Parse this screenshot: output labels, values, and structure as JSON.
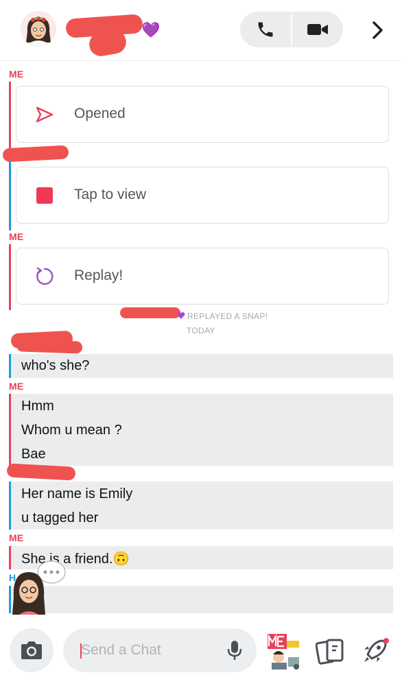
{
  "header": {
    "contact_heart": "💜",
    "call_icon": "phone-icon",
    "video_icon": "video-camera-icon",
    "forward_icon": "chevron-right-icon"
  },
  "labels": {
    "me": "ME",
    "them_partial": "H"
  },
  "snaps": [
    {
      "text": "Opened",
      "icon": "sent-arrow-icon"
    },
    {
      "text": "Tap to view",
      "icon": "red-square-snap-icon"
    },
    {
      "text": "Replay!",
      "icon": "replay-icon"
    }
  ],
  "system": {
    "replayed": "REPLAYED A SNAP!",
    "date": "TODAY"
  },
  "messages": {
    "m1": [
      "who's she?"
    ],
    "m2": [
      "Hmm",
      "Whom u mean ?",
      "Bae"
    ],
    "m3": [
      "Her name is Emily",
      "u tagged her"
    ],
    "m4": [
      "She is a friend.🙃"
    ]
  },
  "composer": {
    "placeholder": "Send a Chat"
  },
  "colors": {
    "me": "#e8415a",
    "them": "#1e9bd7",
    "redaction": "#ef5350",
    "replay": "#9b59c9"
  }
}
